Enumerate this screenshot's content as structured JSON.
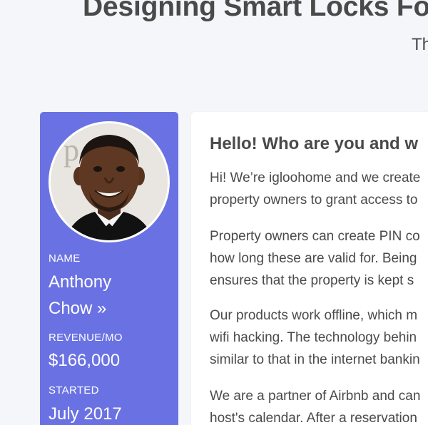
{
  "header": {
    "title": "Designing Smart Locks Fo",
    "subtitle": "Th"
  },
  "profile": {
    "avatar_icon": "founder-photo",
    "name_label": "NAME",
    "name_line1": "Anthony",
    "name_line2": "Chow »",
    "revenue_label": "REVENUE/MO",
    "revenue_value": "$166,000",
    "started_label": "STARTED",
    "started_value": "July 2017"
  },
  "article": {
    "heading": "Hello! Who are you and w",
    "paragraphs": [
      [
        "Hi! We’re igloohome and we create",
        "property owners to grant access to"
      ],
      [
        "Property owners can create PIN co",
        "how long these are valid for. Being",
        "ensures that the property is kept s"
      ],
      [
        "Our products work offline, which m",
        "wifi hacking. The technology behin",
        "similar to that in the internet bankin"
      ],
      [
        "We are a partner of Airbnb and can",
        "host's calendar. After a reservation"
      ]
    ]
  },
  "colors": {
    "sidebar_bg": "#6a72e3",
    "page_bg": "#f4f6f9",
    "text": "#4a4a4a"
  }
}
